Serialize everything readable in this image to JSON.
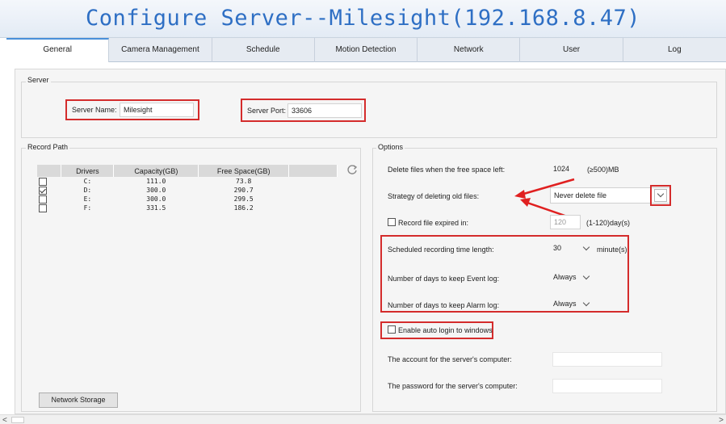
{
  "window": {
    "title": "Configure Server--Milesight(192.168.8.47)"
  },
  "tabs": [
    "General",
    "Camera Management",
    "Schedule",
    "Motion Detection",
    "Network",
    "User",
    "Log"
  ],
  "server": {
    "legend": "Server",
    "name_label": "Server Name:",
    "name_value": "Milesight",
    "port_label": "Server Port:",
    "port_value": "33606"
  },
  "record_path": {
    "legend": "Record Path",
    "columns": [
      "Drivers",
      "Capacity(GB)",
      "Free Space(GB)"
    ],
    "rows": [
      {
        "checked": false,
        "drive": "C:",
        "capacity": "111.0",
        "free": "73.8"
      },
      {
        "checked": true,
        "drive": "D:",
        "capacity": "300.0",
        "free": "290.7"
      },
      {
        "checked": false,
        "drive": "E:",
        "capacity": "300.0",
        "free": "299.5"
      },
      {
        "checked": false,
        "drive": "F:",
        "capacity": "331.5",
        "free": "186.2"
      }
    ],
    "network_storage_label": "Network Storage"
  },
  "options": {
    "legend": "Options",
    "delete_label": "Delete files when the free space left:",
    "delete_value": "1024",
    "delete_unit": "(≥500)MB",
    "strategy_label": "Strategy of deleting old files:",
    "strategy_value": "Never delete file",
    "record_expired_label": "Record file expired in:",
    "record_expired_value": "120",
    "record_expired_unit": "(1-120)day(s)",
    "scheduled_label": "Scheduled recording time length:",
    "scheduled_value": "30",
    "scheduled_unit": "minute(s)",
    "event_log_label": "Number of days to keep Event log:",
    "event_log_value": "Always",
    "alarm_log_label": "Number of days to keep Alarm log:",
    "alarm_log_value": "Always",
    "auto_login_label": "Enable auto login to windows",
    "account_label": "The account for the server's computer:",
    "password_label": "The password for the server's computer:"
  },
  "colors": {
    "title": "#2e6fc4",
    "highlight": "#d42c2c",
    "tab_active_accent": "#4a90d9"
  }
}
